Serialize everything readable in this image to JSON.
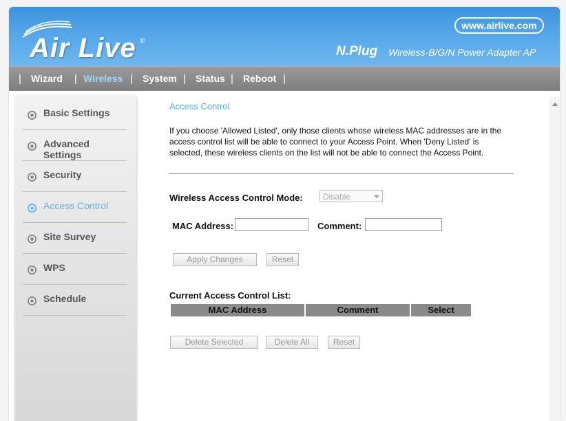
{
  "header": {
    "logo_text": "Air Live",
    "logo_reg": "®",
    "url": "www.airlive.com",
    "model": "N.Plug",
    "product": "Wireless-B/G/N Power Adapter AP"
  },
  "nav": {
    "items": [
      {
        "label": "Wizard"
      },
      {
        "label": "Wireless",
        "active": true
      },
      {
        "label": "System"
      },
      {
        "label": "Status"
      },
      {
        "label": "Reboot"
      }
    ],
    "separator": "|"
  },
  "sidebar": {
    "items": [
      {
        "label": "Basic Settings"
      },
      {
        "label": "Advanced Settings"
      },
      {
        "label": "Security"
      },
      {
        "label": "Access Control",
        "active": true
      },
      {
        "label": "Site Survey"
      },
      {
        "label": "WPS"
      },
      {
        "label": "Schedule"
      }
    ]
  },
  "main": {
    "title": "Access Control",
    "description": "If you choose 'Allowed Listed', only those clients whose wireless MAC addresses are in the access control list will be able to connect to your Access Point. When 'Deny Listed' is selected, these wireless clients on the list will not be able to connect the Access Point.",
    "mode_label": "Wireless Access Control Mode:",
    "mode_value": "Disable",
    "mac_label": "MAC Address:",
    "mac_value": "",
    "comment_label": "Comment:",
    "comment_value": "",
    "apply_label": "Apply Changes",
    "reset_label": "Reset",
    "list_title": "Current Access Control List:",
    "table_headers": [
      "MAC Address",
      "Comment",
      "Select"
    ],
    "delete_selected_label": "Delete Selected",
    "delete_all_label": "Delete All",
    "reset2_label": "Reset"
  },
  "colors": {
    "header_blue": "#4fa3e6",
    "nav_gray": "#8c8c8c",
    "accent": "#57b0e8"
  }
}
